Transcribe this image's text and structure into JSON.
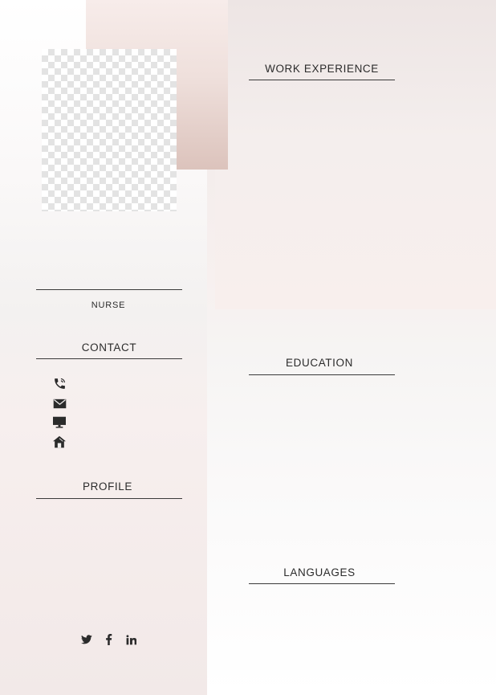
{
  "profile_section": {
    "job_title": "NURSE",
    "contact_heading": "CONTACT",
    "contact_icons": [
      "phone-icon",
      "email-icon",
      "website-icon",
      "home-icon"
    ],
    "profile_heading": "PROFILE",
    "social_icons": [
      "twitter-icon",
      "facebook-icon",
      "linkedin-icon"
    ]
  },
  "main_section": {
    "work_heading": "WORK EXPERIENCE",
    "education_heading": "EDUCATION",
    "languages_heading": "LANGUAGES"
  },
  "colors": {
    "accent": "#dcc3bc",
    "text": "#2b2b2b",
    "rule": "#3a3a3a"
  }
}
